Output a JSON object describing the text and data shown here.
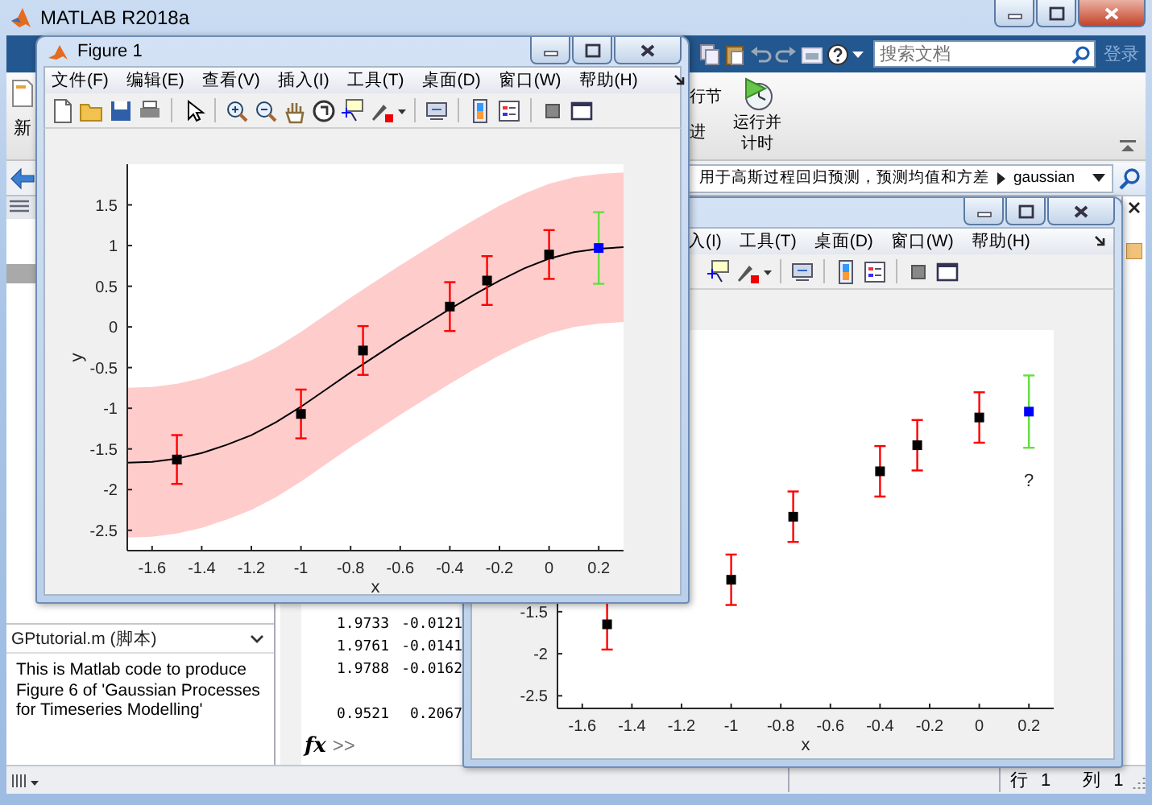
{
  "main_window": {
    "title": "MATLAB R2018a",
    "toolstrip": {
      "search": {
        "placeholder": "搜索文档"
      },
      "sign_in": "登录"
    },
    "ribbon": {
      "new_label": "新",
      "section_labels": [
        "行节",
        "进"
      ],
      "run_and_time": "运行并计时"
    },
    "address_bar": {
      "path": [
        "用于高斯过程回归预测，预测均值和方差",
        "gaussian"
      ]
    },
    "details_panel": {
      "title": "GPtutorial.m  (脚本)",
      "description": "This is Matlab code to produce Figure 6 of 'Gaussian Processes for Timeseries Modelling'"
    },
    "command_window": {
      "rows": [
        {
          "cells": [
            "1.9733",
            "-0.0121"
          ],
          "gap_before": false
        },
        {
          "cells": [
            "1.9761",
            "-0.0141"
          ],
          "gap_before": false
        },
        {
          "cells": [
            "1.9788",
            "-0.0162"
          ],
          "gap_before": false
        },
        {
          "cells": [
            "0.9521",
            "0.2067"
          ],
          "gap_before": true
        }
      ],
      "function_button": "fx",
      "prompt": ">>"
    },
    "status_bar": {
      "line_label": "行",
      "line": "1",
      "column_label": "列",
      "column": "1"
    }
  },
  "figures": [
    {
      "title": "Figure 1",
      "menu": [
        "文件(F)",
        "编辑(E)",
        "查看(V)",
        "插入(I)",
        "工具(T)",
        "桌面(D)",
        "窗口(W)",
        "帮助(H)"
      ],
      "prediction_curve": true,
      "chart_data": {
        "type": "scatter",
        "xlabel": "x",
        "ylabel": "y",
        "xlim": [
          -1.7,
          0.3
        ],
        "ylim": [
          -2.75,
          2.0
        ],
        "xticks": [
          -1.6,
          -1.4,
          -1.2,
          -1,
          -0.8,
          -0.6,
          -0.4,
          -0.2,
          0,
          0.2
        ],
        "yticks": [
          -2.5,
          -2,
          -1.5,
          -1,
          -0.5,
          0,
          0.5,
          1,
          1.5
        ],
        "series": [
          {
            "color": "#000000",
            "x": [
              -1.5,
              -1,
              -0.75,
              -0.4,
              -0.25,
              0
            ],
            "values": [
              -1.63,
              -1.07,
              -0.29,
              0.25,
              0.57,
              0.89
            ],
            "errors": [
              0.3,
              0.3,
              0.3,
              0.3,
              0.3,
              0.3
            ],
            "marker": "square"
          },
          {
            "color": "#0000ff",
            "x": [
              0.2
            ],
            "values": [
              0.97
            ],
            "errors": [
              0.44
            ],
            "marker": "square"
          }
        ]
      }
    },
    {
      "menu": [
        "入(I)",
        "工具(T)",
        "桌面(D)",
        "窗口(W)",
        "帮助(H)"
      ],
      "prediction_curve": false,
      "chart_data": {
        "type": "scatter",
        "xlabel": "x",
        "xlim": [
          -1.7,
          0.3
        ],
        "ylim": [
          -2.65,
          1.85
        ],
        "xticks": [
          -1.6,
          -1.4,
          -1.2,
          -1,
          -0.8,
          -0.6,
          -0.4,
          -0.2,
          0,
          0.2
        ],
        "yticks": [
          -2.5,
          -2,
          -1.5
        ],
        "series": [
          {
            "color": "#000000",
            "x": [
              -1.5,
              -1,
              -0.75,
              -0.4,
              -0.25,
              0
            ],
            "values": [
              -1.65,
              -1.12,
              -0.37,
              0.17,
              0.48,
              0.81
            ],
            "errors": [
              0.3,
              0.3,
              0.3,
              0.3,
              0.3,
              0.3
            ],
            "marker": "square"
          },
          {
            "color": "#0000ff",
            "x": [
              0.2
            ],
            "values": [
              0.88
            ],
            "errors": [
              0.43
            ],
            "marker": "square"
          }
        ],
        "annotations": [
          "?"
        ]
      }
    }
  ]
}
